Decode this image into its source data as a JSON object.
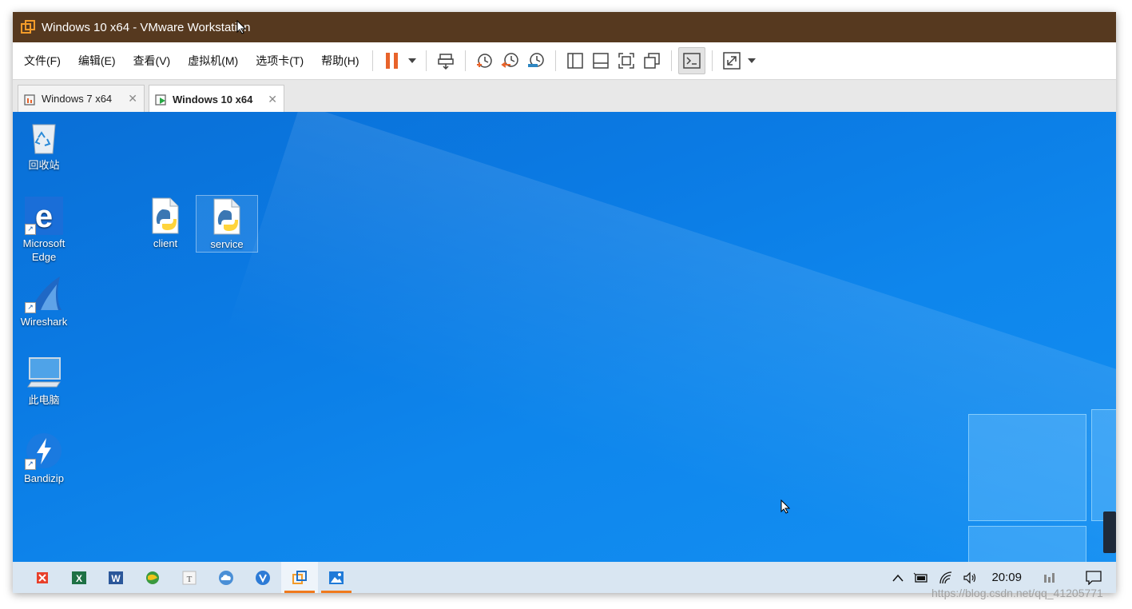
{
  "window": {
    "title": "Windows 10 x64 - VMware Workstation"
  },
  "menu": [
    "文件(F)",
    "编辑(E)",
    "查看(V)",
    "虚拟机(M)",
    "选项卡(T)",
    "帮助(H)"
  ],
  "toolbar": {
    "icons": [
      "pause-icon",
      "dropdown-icon",
      "send-ctrl-alt-del-icon",
      "snapshot-icon",
      "revert-snapshot-icon",
      "snapshot-manager-icon",
      "show-library-icon",
      "thumbnail-bar-icon",
      "full-screen-icon",
      "unity-icon",
      "console-view-icon",
      "stretch-icon",
      "dropdown-icon"
    ]
  },
  "tabs": [
    {
      "label": "Windows 7 x64",
      "active": false
    },
    {
      "label": "Windows 10 x64",
      "active": true
    }
  ],
  "desktop": {
    "icons": [
      {
        "label": "回收站",
        "icon": "recycle-bin-icon"
      },
      {
        "label": "Microsoft Edge",
        "icon": "edge-icon"
      },
      {
        "label": "Wireshark",
        "icon": "wireshark-icon"
      },
      {
        "label": "此电脑",
        "icon": "this-pc-icon"
      },
      {
        "label": "Bandizip",
        "icon": "bandizip-icon"
      },
      {
        "label": "client",
        "icon": "python-file-icon"
      },
      {
        "label": "service",
        "icon": "python-file-icon"
      }
    ]
  },
  "taskbar": {
    "apps": [
      "wps-icon",
      "excel-icon",
      "word-icon",
      "browser-icon",
      "typora-icon",
      "cloud-icon",
      "vivaldi-icon",
      "vmware-icon",
      "photos-icon"
    ],
    "time": "20:09"
  },
  "watermark": "https://blog.csdn.net/qq_41205771",
  "colors": {
    "titlebar": "#56391f",
    "desktop": "#0b7be4",
    "accent": "#f07a1d"
  }
}
